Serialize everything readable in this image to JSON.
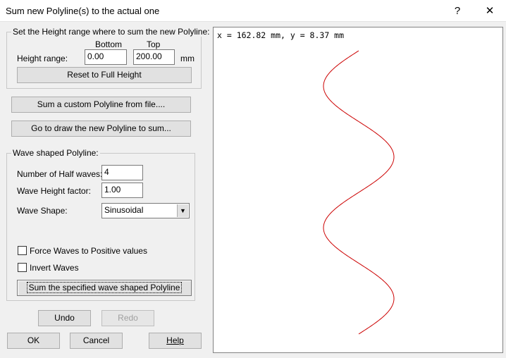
{
  "window": {
    "title": "Sum new Polyline(s) to the actual one",
    "help_glyph": "?",
    "close_glyph": "✕"
  },
  "height_group": {
    "legend": "Set the Height range where to sum the new Polyline:",
    "bottom_label": "Bottom",
    "top_label": "Top",
    "range_label": "Height range:",
    "bottom_value": "0.00",
    "top_value": "200.00",
    "unit": "mm",
    "reset_button": "Reset to Full Height"
  },
  "actions": {
    "custom_polyline": "Sum a custom Polyline from file....",
    "draw_polyline": "Go to draw the new Polyline to sum..."
  },
  "wave_group": {
    "legend": "Wave shaped Polyline:",
    "half_waves_label": "Number of Half waves:",
    "half_waves_value": "4",
    "height_factor_label": "Wave Height factor:",
    "height_factor_value": "1.00",
    "shape_label": "Wave Shape:",
    "shape_value": "Sinusoidal",
    "force_positive_label": "Force Waves to Positive values",
    "force_positive_checked": false,
    "invert_label": "Invert Waves",
    "invert_checked": false,
    "sum_button": "Sum the specified wave shaped Polyline"
  },
  "edit_buttons": {
    "undo": "Undo",
    "redo": "Redo"
  },
  "dialog_buttons": {
    "ok": "OK",
    "cancel": "Cancel",
    "help": "Help"
  },
  "preview": {
    "coords_text": "x = 162.82 mm, y = 8.37 mm",
    "curve_color": "#cc0000",
    "half_waves": 4
  }
}
